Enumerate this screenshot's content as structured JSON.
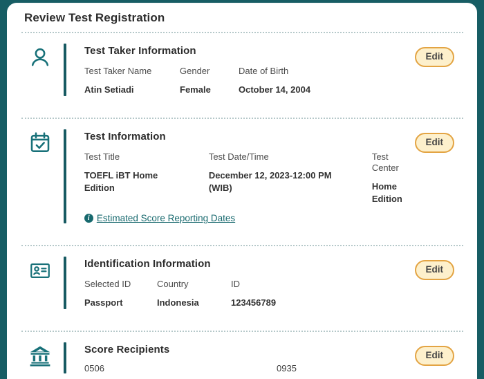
{
  "page": {
    "title": "Review Test Registration"
  },
  "colors": {
    "background_teal": "#175d64",
    "accent_teal": "#187179",
    "link_teal": "#17696e",
    "edit_fill": "#fdf0cc",
    "edit_border": "#e3a443",
    "separator": "#b5c8c9"
  },
  "edit_label": "Edit",
  "sections": [
    {
      "heading": "Test Taker Information",
      "icon": "person-icon",
      "fields": [
        {
          "label": "Test Taker Name",
          "value": "Atin Setiadi"
        },
        {
          "label": "Gender",
          "value": "Female"
        },
        {
          "label": "Date of Birth",
          "value": "October 14, 2004"
        }
      ]
    },
    {
      "heading": "Test Information",
      "icon": "calendar-check-icon",
      "fields": [
        {
          "label": "Test Title",
          "value": "TOEFL iBT Home Edition"
        },
        {
          "label": "Test Date/Time",
          "value": "December 12, 2023-12:00 PM (WIB)"
        },
        {
          "label": "Test Center",
          "value": "Home Edition"
        }
      ],
      "link": {
        "icon": "info-icon",
        "text": "Estimated Score Reporting Dates"
      }
    },
    {
      "heading": "Identification Information",
      "icon": "id-card-icon",
      "fields": [
        {
          "label": "Selected ID",
          "value": "Passport"
        },
        {
          "label": "Country",
          "value": "Indonesia"
        },
        {
          "label": "ID",
          "value": "123456789"
        }
      ]
    },
    {
      "heading": "Score Recipients",
      "icon": "bank-icon",
      "recipients": [
        "0506",
        "0935"
      ]
    }
  ]
}
